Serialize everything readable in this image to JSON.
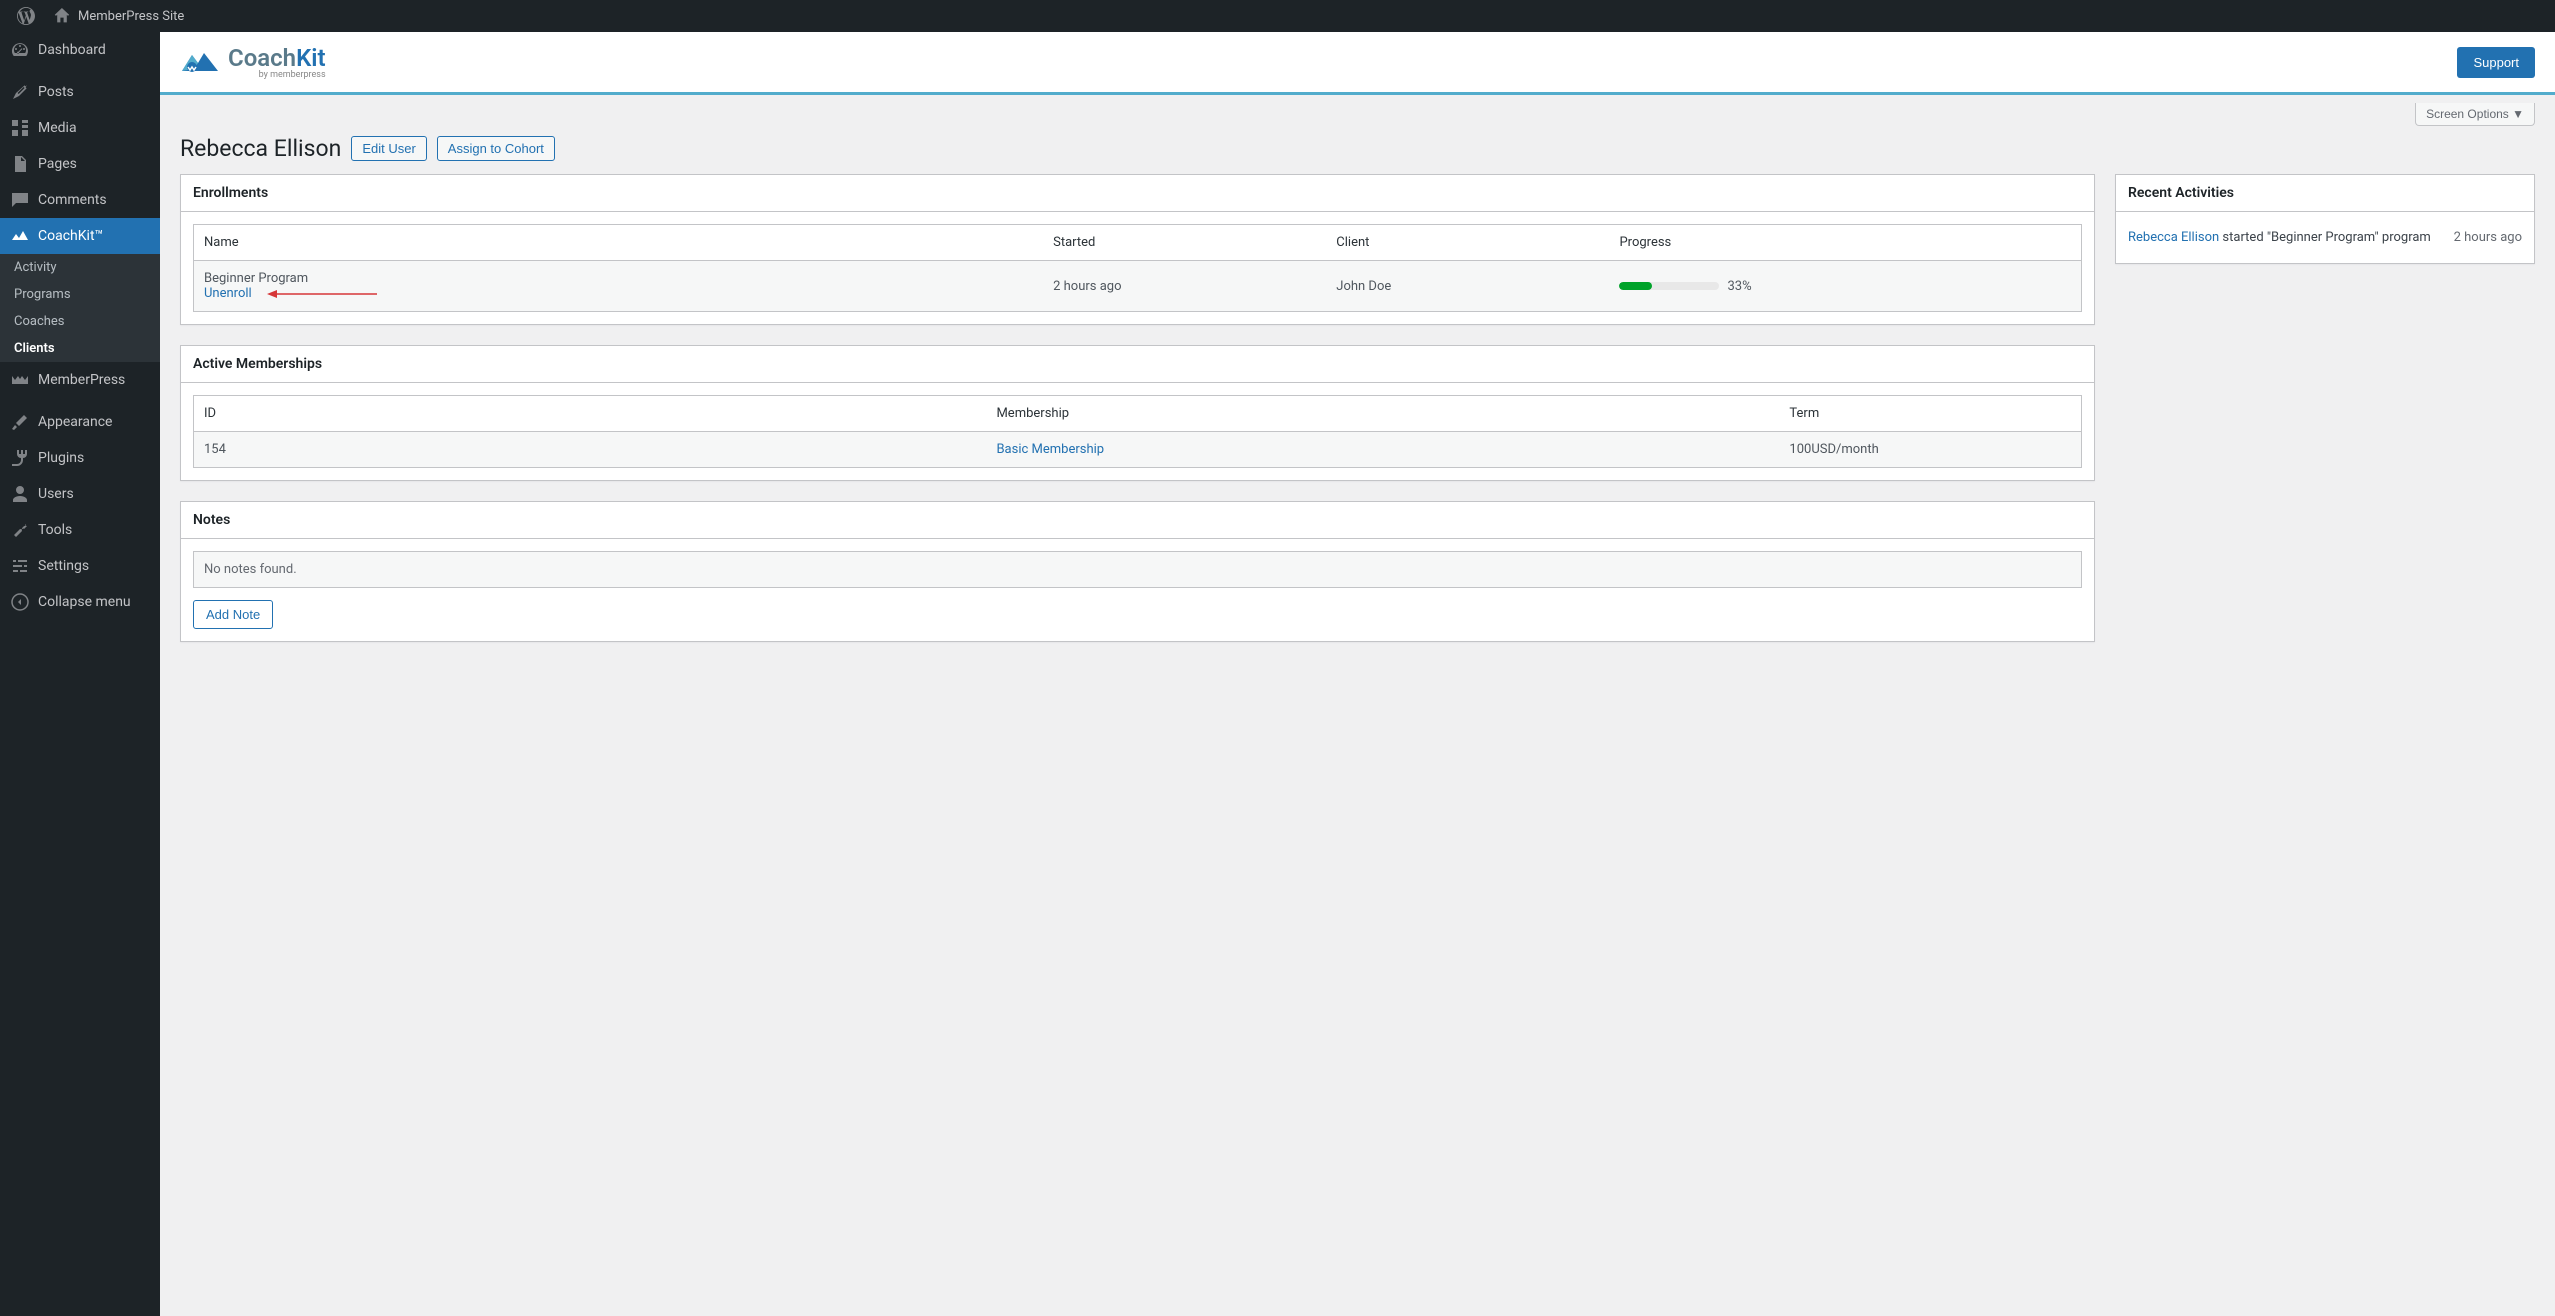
{
  "topbar": {
    "site_name": "MemberPress Site"
  },
  "sidebar": {
    "items": [
      {
        "label": "Dashboard",
        "icon": "dashboard"
      },
      {
        "label": "Posts",
        "icon": "pin"
      },
      {
        "label": "Media",
        "icon": "media"
      },
      {
        "label": "Pages",
        "icon": "pages"
      },
      {
        "label": "Comments",
        "icon": "comments"
      },
      {
        "label": "CoachKit™",
        "icon": "coachkit",
        "active": true
      },
      {
        "label": "MemberPress",
        "icon": "memberpress"
      },
      {
        "label": "Appearance",
        "icon": "brush"
      },
      {
        "label": "Plugins",
        "icon": "plug"
      },
      {
        "label": "Users",
        "icon": "user"
      },
      {
        "label": "Tools",
        "icon": "wrench"
      },
      {
        "label": "Settings",
        "icon": "sliders"
      },
      {
        "label": "Collapse menu",
        "icon": "collapse"
      }
    ],
    "submenu": [
      {
        "label": "Activity"
      },
      {
        "label": "Programs"
      },
      {
        "label": "Coaches"
      },
      {
        "label": "Clients",
        "active": true
      }
    ]
  },
  "brand": {
    "coach": "Coach",
    "kit": "Kit",
    "sub": "by memberpress",
    "support": "Support"
  },
  "screen_options": "Screen Options ▼",
  "page": {
    "title": "Rebecca Ellison",
    "edit_user": "Edit User",
    "assign_cohort": "Assign to Cohort"
  },
  "enrollments": {
    "title": "Enrollments",
    "headers": {
      "name": "Name",
      "started": "Started",
      "client": "Client",
      "progress": "Progress"
    },
    "rows": [
      {
        "name": "Beginner Program",
        "action": "Unenroll",
        "started": "2 hours ago",
        "client": "John Doe",
        "progress_pct": 33,
        "progress_label": "33%"
      }
    ]
  },
  "memberships": {
    "title": "Active Memberships",
    "headers": {
      "id": "ID",
      "membership": "Membership",
      "term": "Term"
    },
    "rows": [
      {
        "id": "154",
        "membership": "Basic Membership",
        "term": "100USD/month"
      }
    ]
  },
  "notes": {
    "title": "Notes",
    "empty": "No notes found.",
    "add": "Add Note"
  },
  "activities": {
    "title": "Recent Activities",
    "rows": [
      {
        "actor": "Rebecca Ellison",
        "text": " started \"Beginner Program\" program",
        "time": "2 hours ago"
      }
    ]
  }
}
